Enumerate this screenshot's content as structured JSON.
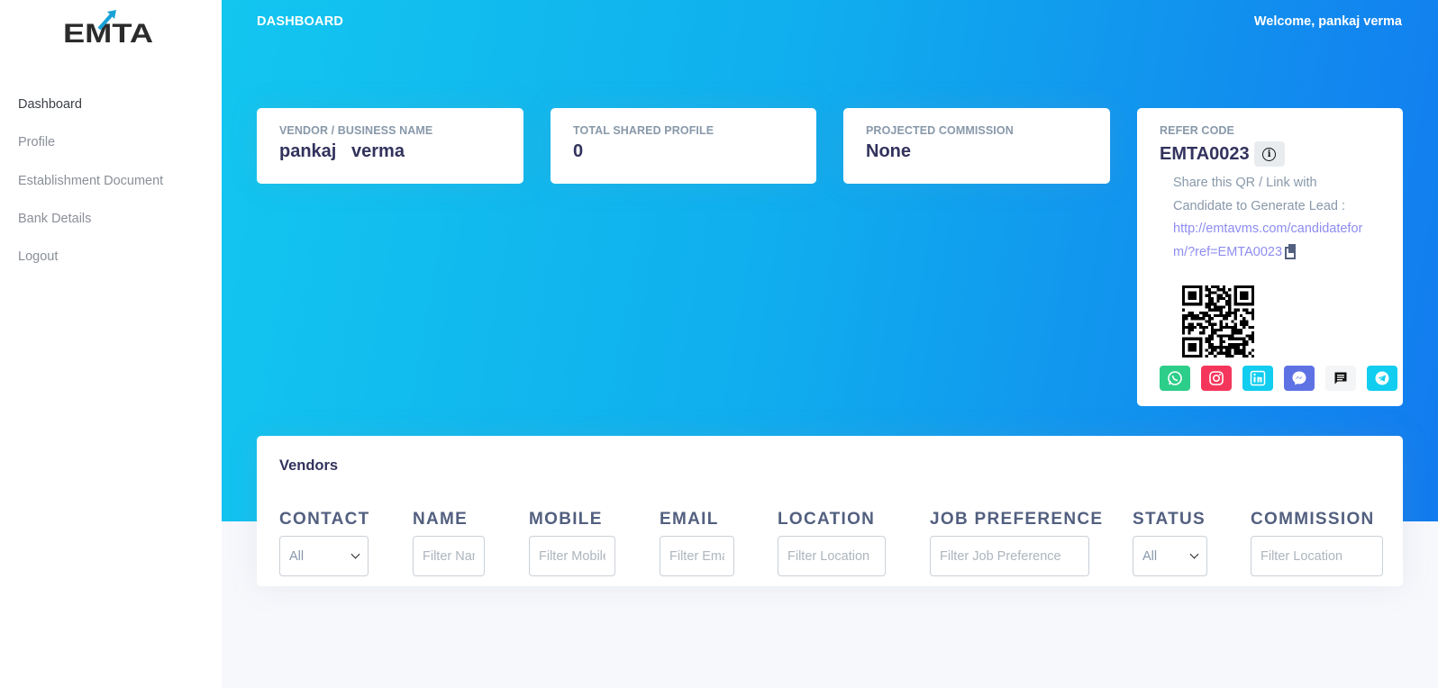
{
  "brand": {
    "logo_text": "EMTA"
  },
  "sidebar": {
    "items": [
      {
        "label": "Dashboard",
        "active": true
      },
      {
        "label": "Profile"
      },
      {
        "label": "Establishment Document"
      },
      {
        "label": "Bank Details"
      },
      {
        "label": "Logout"
      }
    ]
  },
  "header": {
    "title": "DASHBOARD",
    "welcome": "Welcome, pankaj  verma"
  },
  "cards": {
    "vendor": {
      "label": "VENDOR / BUSINESS NAME",
      "value": "pankaj   verma"
    },
    "shared": {
      "label": "TOTAL SHARED PROFILE",
      "value": "0"
    },
    "commission": {
      "label": "PROJECTED COMMISSION",
      "value": "None"
    }
  },
  "refer": {
    "label": "REFER CODE",
    "code": "EMTA0023",
    "share_text": "Share this QR / Link with Candidate to Generate Lead :",
    "link": "http://emtavms.com/candidateform/?ref=EMTA0023",
    "social": [
      {
        "name": "whatsapp-icon",
        "color": "#2dce89"
      },
      {
        "name": "instagram-icon",
        "color": "#f5365c"
      },
      {
        "name": "linkedin-icon",
        "color": "#11cdef"
      },
      {
        "name": "messenger-icon",
        "color": "#5e72e4"
      },
      {
        "name": "sms-icon",
        "color": "#f4f5f7"
      },
      {
        "name": "telegram-icon",
        "color": "#11cdef"
      }
    ]
  },
  "vendors": {
    "title": "Vendors",
    "columns": [
      {
        "header": "CONTACT",
        "type": "select",
        "value": "All"
      },
      {
        "header": "NAME",
        "type": "input",
        "placeholder": "Filter Name"
      },
      {
        "header": "MOBILE",
        "type": "input",
        "placeholder": "Filter Mobile"
      },
      {
        "header": "EMAIL",
        "type": "input",
        "placeholder": "Filter Email"
      },
      {
        "header": "LOCATION",
        "type": "input",
        "placeholder": "Filter Location"
      },
      {
        "header": "JOB PREFERENCE",
        "type": "input",
        "placeholder": "Filter Job Preference"
      },
      {
        "header": "STATUS",
        "type": "select",
        "value": "All"
      },
      {
        "header": "COMMISSION",
        "type": "input",
        "placeholder": "Filter Location"
      }
    ]
  }
}
